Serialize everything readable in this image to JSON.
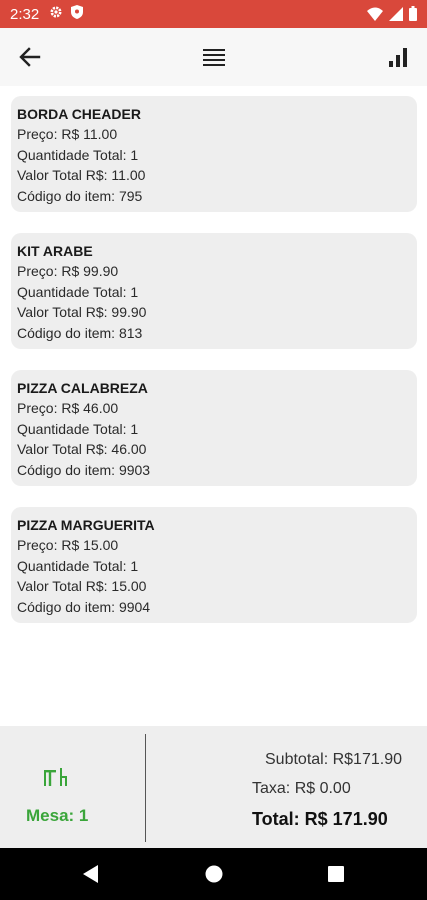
{
  "status_bar": {
    "time": "2:32",
    "background": "#d9483b",
    "icons": [
      "gear-icon",
      "shield-icon",
      "wifi-icon",
      "signal-icon",
      "battery-icon"
    ]
  },
  "toolbar": {
    "icons": [
      "arrow-left-icon",
      "menu-icon",
      "bar-chart-icon"
    ]
  },
  "items": [
    {
      "name": "BORDA CHEADER",
      "preco": "Preço: R$ 11.00",
      "quantidade": "Quantidade Total: 1",
      "valor_total": "Valor Total R$: 11.00",
      "codigo": "Código do item: 795"
    },
    {
      "name": "KIT ARABE",
      "preco": "Preço: R$ 99.90",
      "quantidade": "Quantidade Total: 1",
      "valor_total": "Valor Total R$: 99.90",
      "codigo": "Código do item: 813"
    },
    {
      "name": "PIZZA CALABREZA",
      "preco": "Preço: R$ 46.00",
      "quantidade": "Quantidade Total: 1",
      "valor_total": "Valor Total R$: 46.00",
      "codigo": "Código do item: 9903"
    },
    {
      "name": "PIZZA MARGUERITA",
      "preco": "Preço: R$ 15.00",
      "quantidade": "Quantidade Total: 1",
      "valor_total": "Valor Total R$: 15.00",
      "codigo": "Código do item: 9904"
    }
  ],
  "footer": {
    "mesa": "Mesa: 1",
    "subtotal": "Subtotal: R$171.90",
    "taxa": "Taxa: R$ 0.00",
    "total": "Total: R$ 171.90",
    "accent": "#3aa53a",
    "icon": "table-chairs-icon"
  },
  "nav_bar": {
    "icons": [
      "nav-back-icon",
      "nav-home-icon",
      "nav-recents-icon"
    ]
  }
}
